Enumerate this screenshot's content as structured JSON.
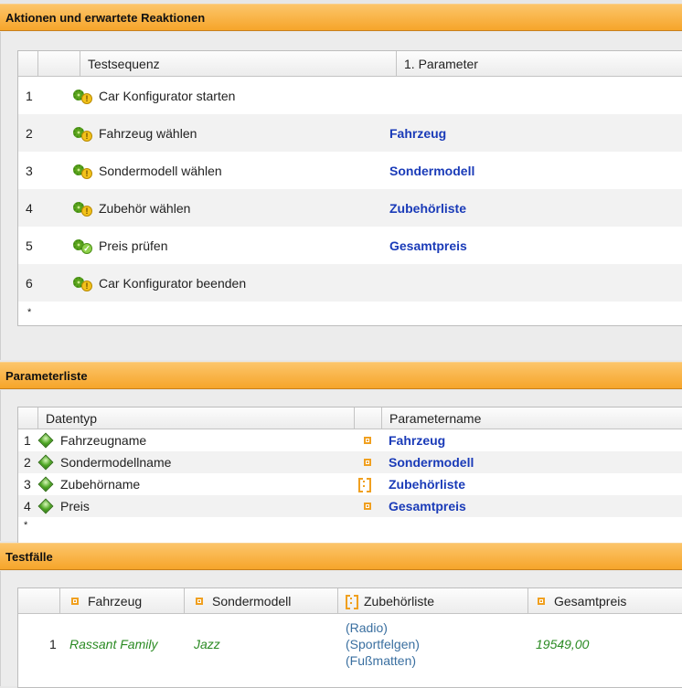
{
  "actions_panel": {
    "title": "Aktionen und erwartete Reaktionen",
    "columns": [
      "Testsequenz",
      "1. Parameter"
    ],
    "rows": [
      {
        "num": "1",
        "label": "Car Konfigurator starten",
        "param": "",
        "icon": "gear-warning-icon"
      },
      {
        "num": "2",
        "label": "Fahrzeug wählen",
        "param": "Fahrzeug",
        "icon": "gear-warning-icon"
      },
      {
        "num": "3",
        "label": "Sondermodell wählen",
        "param": "Sondermodell",
        "icon": "gear-warning-icon"
      },
      {
        "num": "4",
        "label": "Zubehör wählen",
        "param": "Zubehörliste",
        "icon": "gear-warning-icon"
      },
      {
        "num": "5",
        "label": "Preis prüfen",
        "param": "Gesamtpreis",
        "icon": "gear-check-icon"
      },
      {
        "num": "6",
        "label": "Car Konfigurator beenden",
        "param": "",
        "icon": "gear-warning-icon"
      }
    ],
    "new_row_marker": "*"
  },
  "params_panel": {
    "title": "Parameterliste",
    "columns": [
      "Datentyp",
      "Parametername"
    ],
    "rows": [
      {
        "num": "1",
        "type": "Fahrzeugname",
        "kind": "single",
        "name": "Fahrzeug"
      },
      {
        "num": "2",
        "type": "Sondermodellname",
        "kind": "single",
        "name": "Sondermodell"
      },
      {
        "num": "3",
        "type": "Zubehörname",
        "kind": "list",
        "name": "Zubehörliste"
      },
      {
        "num": "4",
        "type": "Preis",
        "kind": "single",
        "name": "Gesamtpreis"
      }
    ],
    "new_row_marker": "*"
  },
  "tests_panel": {
    "title": "Testfälle",
    "columns": [
      {
        "label": "Fahrzeug",
        "icon": "single-value-icon"
      },
      {
        "label": "Sondermodell",
        "icon": "single-value-icon"
      },
      {
        "label": "Zubehörliste",
        "icon": "list-value-icon"
      },
      {
        "label": "Gesamtpreis",
        "icon": "single-value-icon"
      }
    ],
    "rows": [
      {
        "num": "1",
        "fahrzeug": "Rassant Family",
        "sondermodell": "Jazz",
        "zubehoer": [
          "(Radio)",
          "(Sportfelgen)",
          "(Fußmatten)"
        ],
        "gesamtpreis": "19549,00"
      }
    ]
  },
  "colors": {
    "header_orange": "#f6a52a",
    "param_blue": "#1a3bb8",
    "value_green": "#2a8a22"
  }
}
